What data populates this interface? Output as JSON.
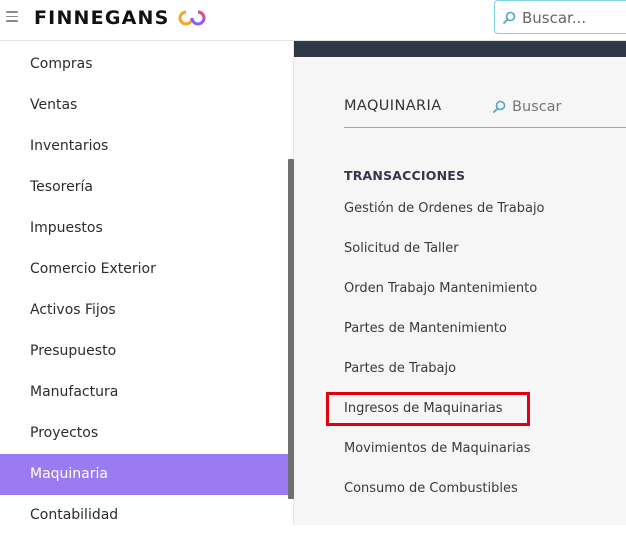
{
  "header": {
    "brand": "FINNEGANS",
    "search_placeholder": "Buscar..."
  },
  "sidebar": {
    "items": [
      {
        "label": "Compras"
      },
      {
        "label": "Ventas"
      },
      {
        "label": "Inventarios"
      },
      {
        "label": "Tesorería"
      },
      {
        "label": "Impuestos"
      },
      {
        "label": "Comercio Exterior"
      },
      {
        "label": "Activos Fijos"
      },
      {
        "label": "Presupuesto"
      },
      {
        "label": "Manufactura"
      },
      {
        "label": "Proyectos"
      },
      {
        "label": "Maquinaria",
        "active": true
      },
      {
        "label": "Contabilidad"
      }
    ]
  },
  "main": {
    "module_title": "MAQUINARIA",
    "search_placeholder": "Buscar",
    "section_title": "TRANSACCIONES",
    "links": [
      {
        "label": "Gestión de Ordenes de Trabajo"
      },
      {
        "label": "Solicitud de Taller"
      },
      {
        "label": "Orden Trabajo Mantenimiento"
      },
      {
        "label": "Partes de Mantenimiento"
      },
      {
        "label": "Partes de Trabajo"
      },
      {
        "label": "Ingresos de Maquinarias",
        "highlighted": true
      },
      {
        "label": "Movimientos de Maquinarias"
      },
      {
        "label": "Consumo de Combustibles"
      }
    ]
  },
  "colors": {
    "active_bg": "#9b7bf2",
    "highlight_border": "#e0000f",
    "search_border": "#7fd3de",
    "dark_strip": "#2f3848"
  },
  "icons": {
    "menu": "hamburger-icon",
    "search": "search-icon",
    "logo": "infinity-logo-icon"
  }
}
